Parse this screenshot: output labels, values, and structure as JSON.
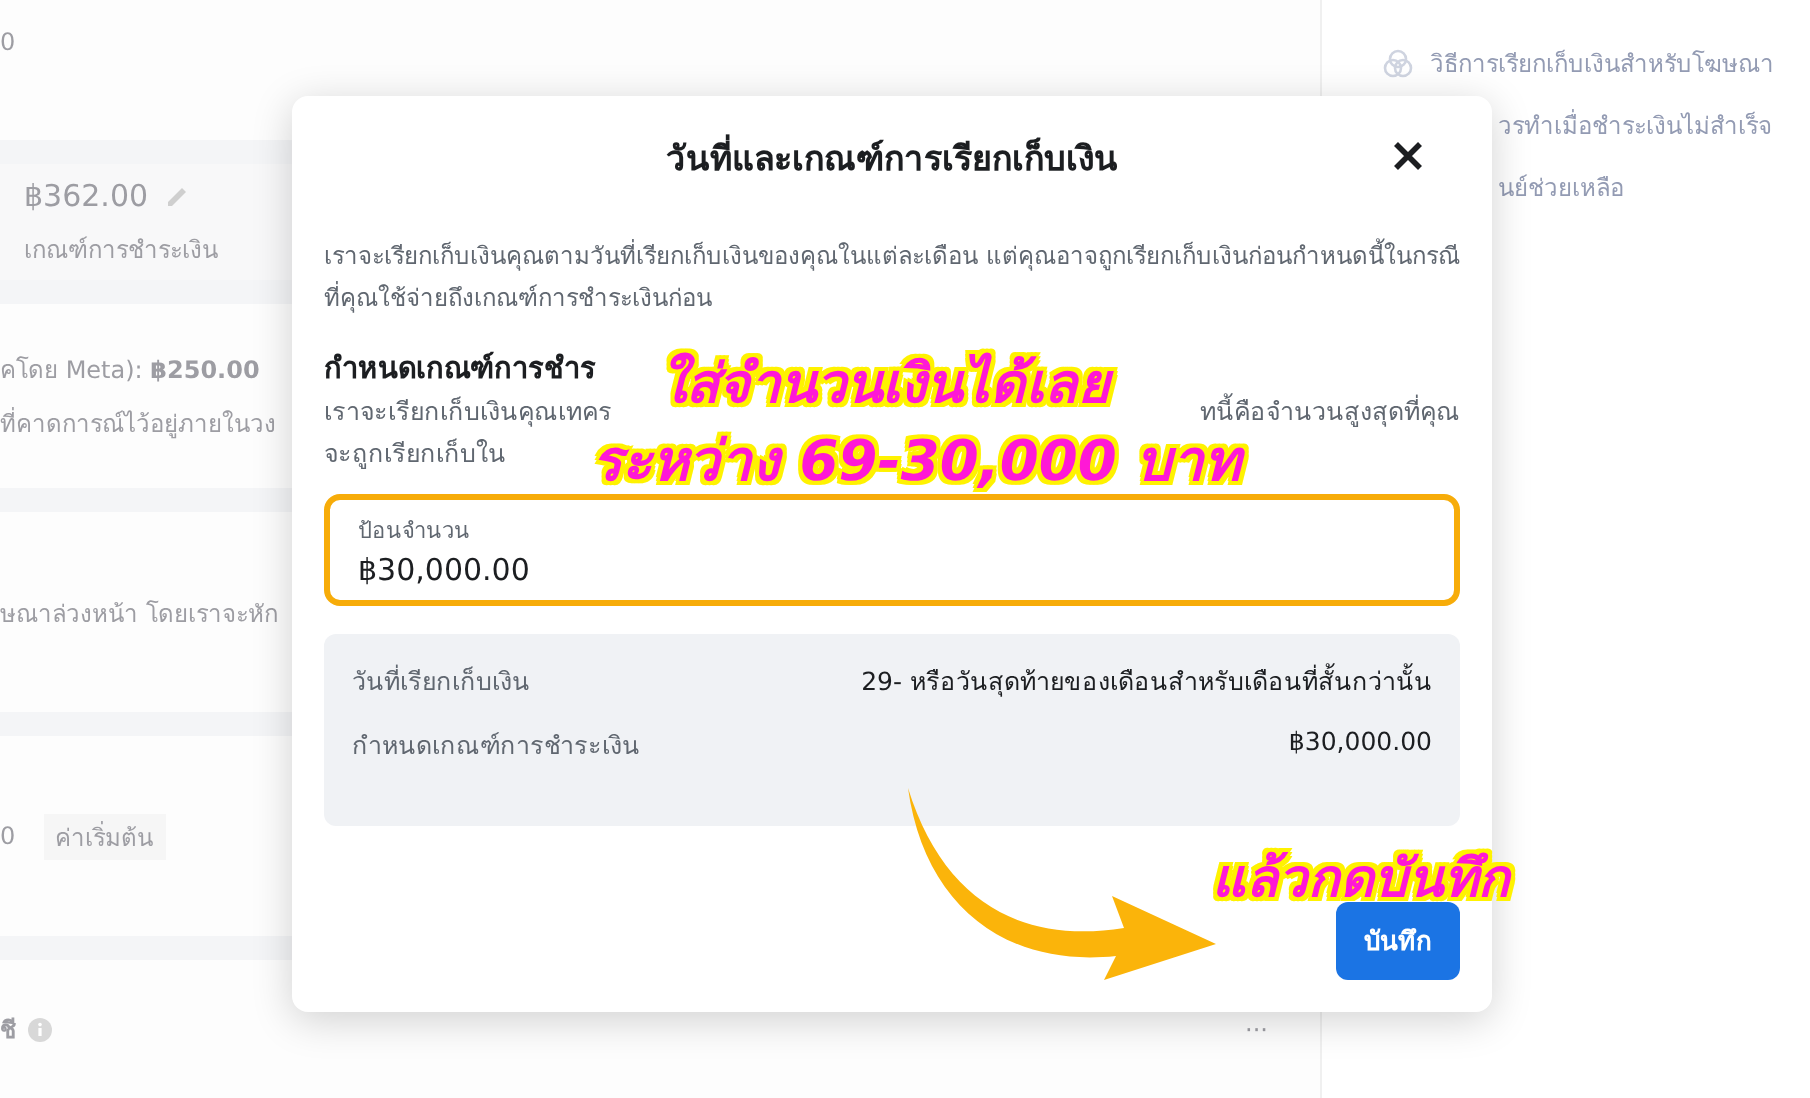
{
  "background": {
    "top_value": "0",
    "amount": "฿362.00",
    "amount_label": "เกณฑ์การชำระเงิน",
    "limit_prefix": "คโดย Meta): ",
    "limit_value": "฿250.00",
    "limit_note": "ที่คาดการณ์ไว้อยู่ภายในวง",
    "prepay_note": "ษณาล่วงหน้า โดยเราจะหัก",
    "default_value": "0",
    "default_tag": "ค่าเริ่มต้น",
    "section_title": "ชี",
    "more": "···"
  },
  "sidebar": {
    "links": [
      "วิธีการเรียกเก็บเงินสำหรับโฆษณา",
      "วรทำเมื่อชำระเงินไม่สำเร็จ",
      "นย์ช่วยเหลือ"
    ]
  },
  "dialog": {
    "title": "วันที่และเกณฑ์การเรียกเก็บเงิน",
    "intro": "เราจะเรียกเก็บเงินคุณตามวันที่เรียกเก็บเงินของคุณในแต่ละเดือน แต่คุณอาจถูกเรียกเก็บเงินก่อนกำหนดนี้ในกรณีที่คุณใช้จ่ายถึงเกณฑ์การชำระเงินก่อน",
    "section_heading": "กำหนดเกณฑ์การชำร",
    "section_lines": [
      {
        "left": "เราจะเรียกเก็บเงินคุณเทคร",
        "right": "ทนี้คือจำนวนสูงสุดที่คุณ"
      },
      {
        "left": "จะถูกเรียกเก็บใน"
      }
    ],
    "field": {
      "label": "ป้อนจำนวน",
      "value": "฿30,000.00"
    },
    "summary": [
      {
        "label": "วันที่เรียกเก็บเงิน",
        "value": "29- หรือวันสุดท้ายของเดือนสำหรับเดือนที่สั้นกว่านั้น"
      },
      {
        "label": "กำหนดเกณฑ์การชำระเงิน",
        "value": "฿30,000.00"
      }
    ],
    "save": "บันทึก"
  },
  "annotations": [
    "ใส่จำนวนเงินได้เลย",
    "ระหว่าง 69-30,000 บาท",
    "แล้วกดบันทึก"
  ]
}
